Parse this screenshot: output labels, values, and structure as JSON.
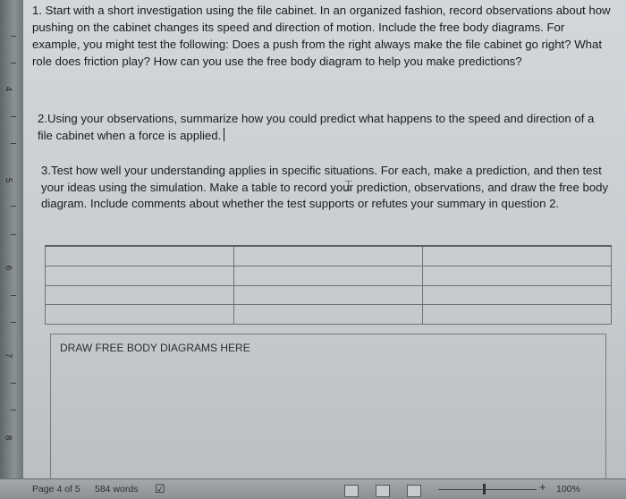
{
  "ruler": {
    "numbers": [
      "4",
      "5",
      "6",
      "7",
      "8"
    ]
  },
  "paragraphs": {
    "p1": "1. Start with a short investigation using the file cabinet. In an organized fashion, record observations about how pushing on the cabinet changes its speed and direction of motion. Include the free body diagrams. For example, you might test the following: Does a push from the right always make the file cabinet go right? What role does friction play? How can you use the free body diagram to help you make predictions?",
    "p2": "2.Using your observations, summarize how you could predict what happens to the speed and direction of a file cabinet when a force is applied.",
    "p3": "3.Test how well your understanding applies in specific situations. For each, make a prediction, and then test your ideas using the simulation. Make a table to record your prediction, observations, and draw the free body diagram. Include comments about whether the test supports or refutes your summary in question 2."
  },
  "draw_box": {
    "label": "DRAW FREE BODY DIAGRAMS HERE"
  },
  "status_bar": {
    "page": "Page 4 of 5",
    "words": "584 words",
    "zoom": "100%"
  }
}
